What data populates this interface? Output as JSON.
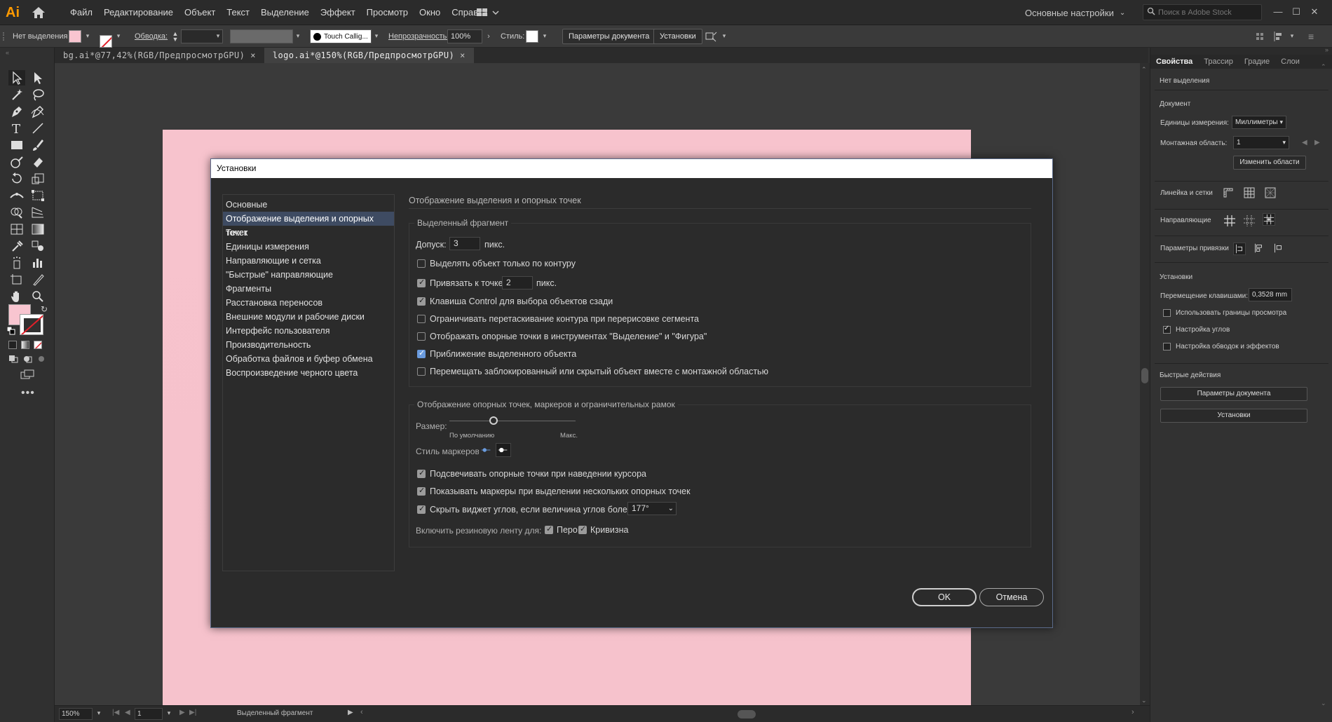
{
  "app": {
    "logo": "Ai",
    "menu": [
      "Файл",
      "Редактирование",
      "Объект",
      "Текст",
      "Выделение",
      "Эффект",
      "Просмотр",
      "Окно",
      "Справка"
    ],
    "workspace": "Основные настройки",
    "stock_search_placeholder": "Поиск в Adobe Stock"
  },
  "controlbar": {
    "selection_label": "Нет выделения",
    "stroke_label": "Обводка:",
    "brush_name": "Touch Callig...",
    "opacity_label": "Непрозрачность:",
    "opacity_value": "100%",
    "style_label": "Стиль:",
    "doc_params_button": "Параметры документа",
    "prefs_button": "Установки"
  },
  "tabs": [
    {
      "label": "bg.ai*@77,42%(RGB/ПредпросмотрGPU)",
      "close": "×",
      "active": false
    },
    {
      "label": "logo.ai*@150%(RGB/ПредпросмотрGPU)",
      "close": "×",
      "active": true
    }
  ],
  "statusbar": {
    "zoom": "150%",
    "artboard": "1",
    "status_text": "Выделенный фрагмент"
  },
  "properties_panel": {
    "tabs": [
      "Свойства",
      "Трассир",
      "Градие",
      "Слои"
    ],
    "no_selection": "Нет выделения",
    "document_section": "Документ",
    "units_label": "Единицы измерения:",
    "units_value": "Миллиметры",
    "artboard_label": "Монтажная область:",
    "artboard_value": "1",
    "edit_artboards_button": "Изменить области",
    "rulers_label": "Линейка и сетки",
    "guides_label": "Направляющие",
    "snap_label": "Параметры привязки",
    "prefs_section": "Установки",
    "keyboard_increment_label": "Перемещение клавишами:",
    "keyboard_increment_value": "0,3528 mm",
    "use_preview_bounds": "Использовать границы просмотра",
    "scale_corners": "Настройка углов",
    "scale_strokes": "Настройка обводок и эффектов",
    "quick_actions_section": "Быстрые действия",
    "quick_doc_params": "Параметры документа",
    "quick_prefs": "Установки"
  },
  "dialog": {
    "title": "Установки",
    "nav": [
      "Основные",
      "Отображение выделения и опорных точек",
      "Текст",
      "Единицы измерения",
      "Направляющие и сетка",
      "\"Быстрые\" направляющие",
      "Фрагменты",
      "Расстановка переносов",
      "Внешние модули и рабочие диски",
      "Интерфейс пользователя",
      "Производительность",
      "Обработка файлов и буфер обмена",
      "Воспроизведение черного цвета"
    ],
    "page_title": "Отображение выделения и опорных точек",
    "selection_group": "Выделенный фрагмент",
    "tolerance_label": "Допуск:",
    "tolerance_value": "3",
    "px_unit": "пикс.",
    "object_by_path": "Выделять объект только по контуру",
    "snap_to_point": "Привязать к точке",
    "snap_value": "2",
    "snap_unit": "пикс.",
    "ctrl_click": "Клавиша Control для выбора объектов сзади",
    "constrain_drag": "Ограничивать перетаскивание контура при перерисовке сегмента",
    "show_anchor_points": "Отображать опорные точки в инструментах \"Выделение\" и \"Фигура\"",
    "zoom_to_selection": "Приближение выделенного объекта",
    "move_locked": "Перемещать заблокированный или скрытый объект вместе с монтажной областью",
    "anchor_group": "Отображение опорных точек, маркеров и ограничительных рамок",
    "size_label": "Размер:",
    "size_default": "По умолчанию",
    "size_max": "Макс.",
    "size_value": 0.35,
    "handle_style_label": "Стиль маркеров:",
    "highlight_anchors": "Подсвечивать опорные точки при наведении курсора",
    "show_handles": "Показывать маркеры при выделении нескольких опорных точек",
    "hide_corner_widget": "Скрыть виджет углов, если величина углов более:",
    "corner_value": "177°",
    "rubber_band_label": "Включить резиновую ленту для:",
    "rubber_pen": "Перо",
    "rubber_curvature": "Кривизна",
    "ok_button": "OK",
    "cancel_button": "Отмена"
  },
  "colors": {
    "artboard": "#f7c3cd",
    "accent_selection": "#3e4b62",
    "logo": "#ff9a00"
  }
}
